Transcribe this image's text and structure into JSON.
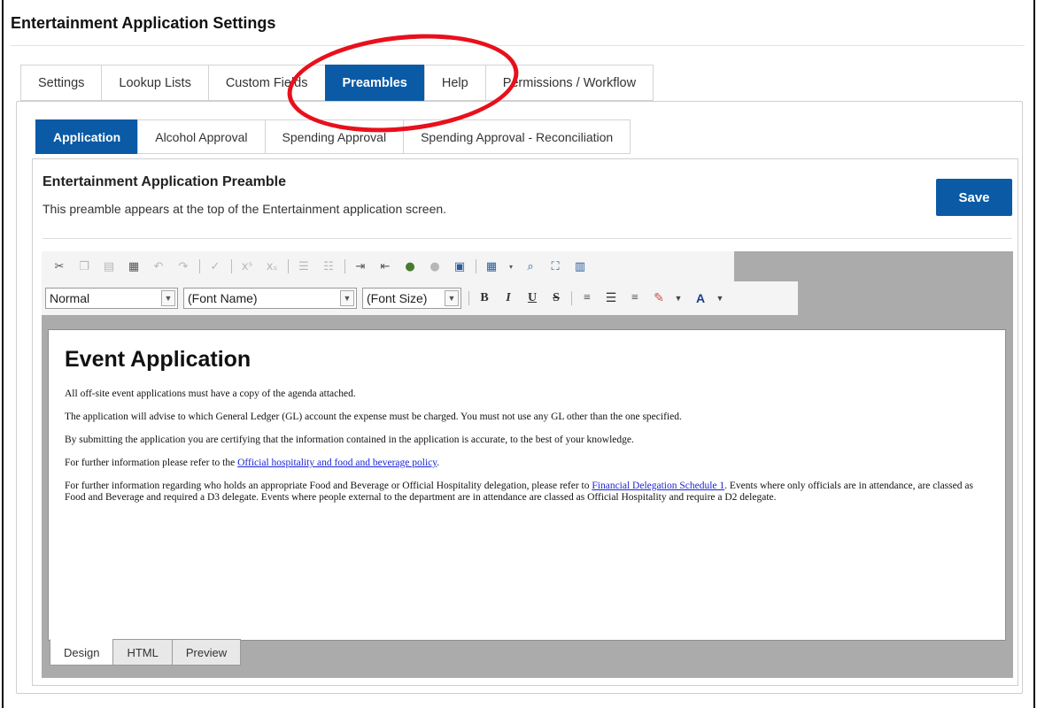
{
  "page": {
    "title": "Entertainment Application Settings"
  },
  "main_tabs": [
    {
      "label": "Settings",
      "active": false
    },
    {
      "label": "Lookup Lists",
      "active": false
    },
    {
      "label": "Custom Fields",
      "active": false
    },
    {
      "label": "Preambles",
      "active": true
    },
    {
      "label": "Help",
      "active": false
    },
    {
      "label": "Permissions / Workflow",
      "active": false
    }
  ],
  "sub_tabs": [
    {
      "label": "Application",
      "active": true
    },
    {
      "label": "Alcohol Approval",
      "active": false
    },
    {
      "label": "Spending Approval",
      "active": false
    },
    {
      "label": "Spending Approval - Reconciliation",
      "active": false
    }
  ],
  "preamble": {
    "title": "Entertainment Application Preamble",
    "description": "This preamble appears at the top of the Entertainment application screen.",
    "save_label": "Save"
  },
  "toolbar": {
    "row1_icons": [
      "cut-icon",
      "copy-icon",
      "paste-icon",
      "paste-from-word-icon",
      "undo-icon",
      "redo-icon",
      "spell-check-icon",
      "superscript-icon",
      "subscript-icon",
      "bulleted-list-icon",
      "numbered-list-icon",
      "indent-icon",
      "outdent-icon",
      "insert-link-icon",
      "remove-link-icon",
      "insert-image-icon",
      "insert-table-icon",
      "table-dropdown-icon",
      "find-icon",
      "fullscreen-icon",
      "columns-icon"
    ],
    "format_select": "Normal",
    "font_name_select": "(Font Name)",
    "font_size_select": "(Font Size)",
    "row2_buttons": [
      "bold-icon",
      "italic-icon",
      "underline-icon",
      "strikethrough-icon",
      "align-left-icon",
      "align-center-icon",
      "align-right-icon",
      "highlight-color-icon",
      "font-color-icon"
    ]
  },
  "content": {
    "heading": "Event Application",
    "p1": "All off-site event applications must have a copy of the agenda attached.",
    "p2": "The application will advise to which General Ledger (GL) account the expense must be charged. You must not use any GL other than the one specified.",
    "p3": "By submitting the application you are certifying that the information contained in the application is accurate, to the best of your knowledge.",
    "p4_prefix": "For further information please refer to the ",
    "p4_link": "Official hospitality and food and beverage policy",
    "p4_suffix": ".",
    "p5_prefix": "For further information regarding who holds an appropriate Food and Beverage or Official Hospitality delegation, please refer to ",
    "p5_link": "Financial Delegation Schedule 1",
    "p5_suffix": ".  Events where only officials are in attendance, are classed as Food and Beverage and required a D3 delegate.  Events where people external to the department are in attendance are classed as Official Hospitality and require a D2 delegate."
  },
  "mode_tabs": [
    {
      "label": "Design",
      "active": true
    },
    {
      "label": "HTML",
      "active": false
    },
    {
      "label": "Preview",
      "active": false
    }
  ],
  "colors": {
    "accent": "#0a5aa6",
    "annotation": "#e8101c",
    "link": "#1a24d6"
  }
}
